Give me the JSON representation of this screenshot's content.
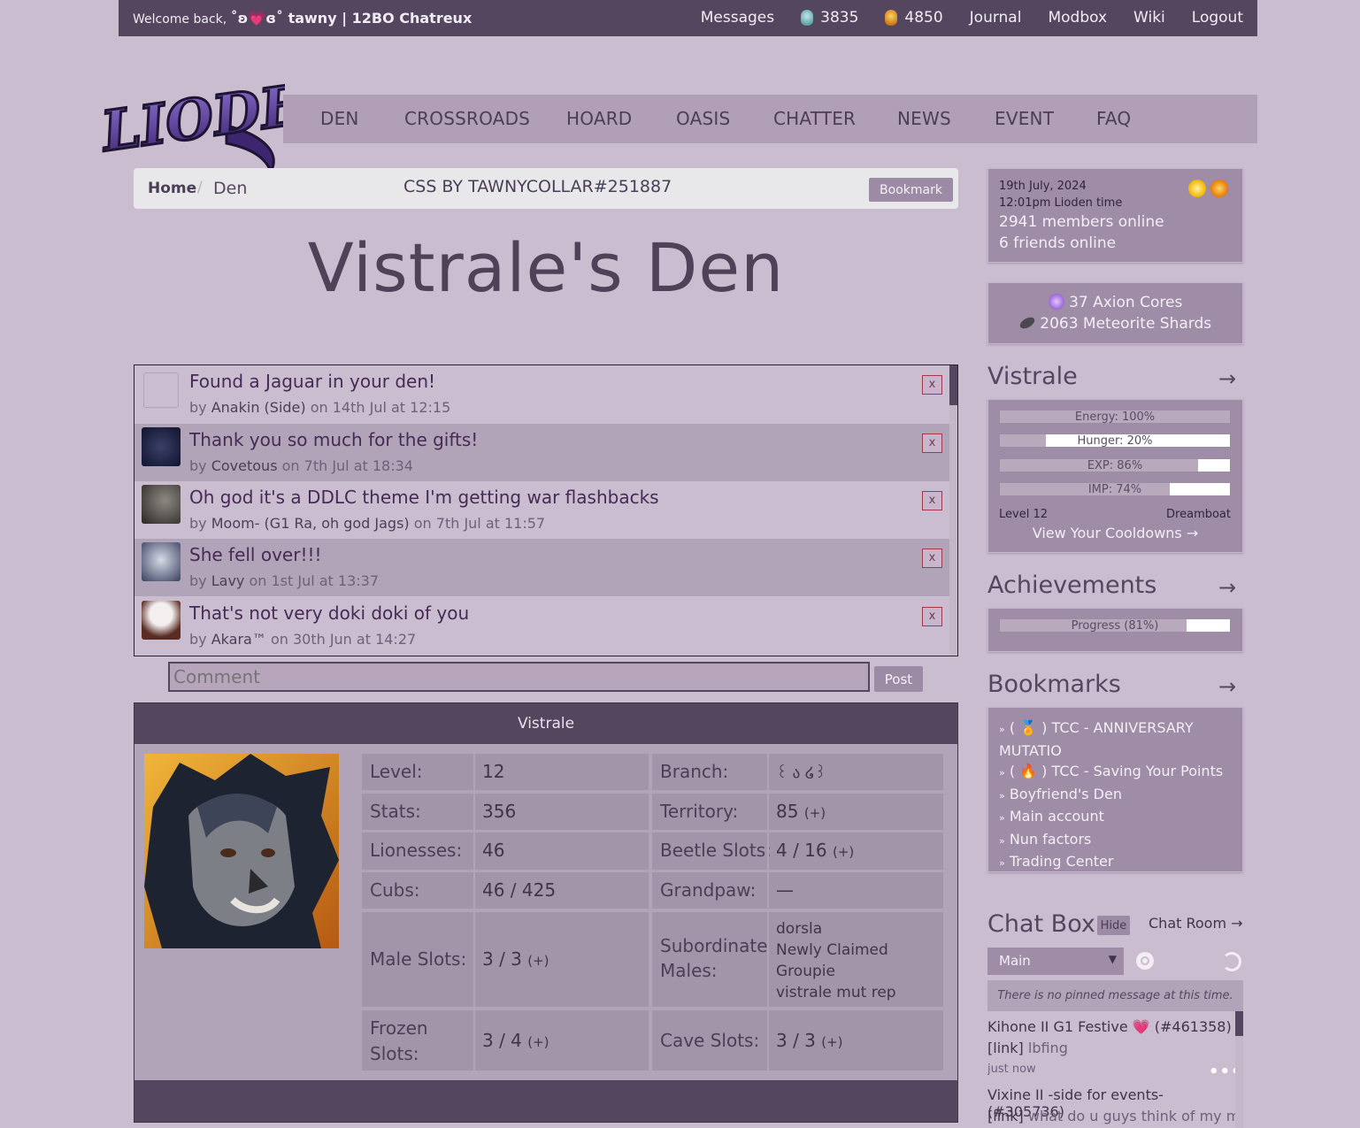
{
  "topbar": {
    "welcome_prefix": "Welcome back,",
    "username": "˚ʚ💗ɞ˚ tawny | 12BO Chatreux",
    "nav": [
      "Messages",
      "Journal",
      "Modbox",
      "Wiki",
      "Logout"
    ],
    "currency_teal": "3835",
    "currency_gold": "4850"
  },
  "logo": {
    "text": "LIODEN"
  },
  "mainnav": [
    "DEN",
    "CROSSROADS",
    "HOARD",
    "OASIS",
    "CHATTER",
    "NEWS",
    "EVENT",
    "FAQ"
  ],
  "breadcrumb": {
    "home": "Home",
    "sep": "/",
    "current": "Den",
    "credit": "CSS BY TAWNYCOLLAR#251887",
    "bookmark": "Bookmark"
  },
  "page_title": "Vistrale's Den",
  "comments": [
    {
      "title": "Found a Jaguar in your den!",
      "by": "by",
      "author": "Anakin (Side)",
      "date": "on 14th Jul at 12:15",
      "close": "x"
    },
    {
      "title": "Thank you so much for the gifts!",
      "by": "by",
      "author": "Covetous",
      "date": "on 7th Jul at 18:34",
      "close": "x"
    },
    {
      "title": "Oh god it's a DDLC theme I'm getting war flashbacks",
      "by": "by",
      "author": "Moom- (G1 Ra, oh god Jags)",
      "date": "on 7th Jul at 11:57",
      "close": "x"
    },
    {
      "title": "She fell over!!!",
      "by": "by",
      "author": "Lavy",
      "date": "on 1st Jul at 13:37",
      "close": "x"
    },
    {
      "title": "That's not very doki doki of you",
      "by": "by",
      "author": "Akara™",
      "date": "on 30th Jun at 14:27",
      "close": "x"
    }
  ],
  "comment_form": {
    "placeholder": "Comment",
    "post": "Post"
  },
  "lion": {
    "name": "Vistrale",
    "level_label": "Level:",
    "level": "12",
    "branch_label": "Branch:",
    "branch": "꒰ ა ໒꒱",
    "stats_label": "Stats:",
    "stats": "356",
    "territory_label": "Territory:",
    "territory": "85",
    "lionesses_label": "Lionesses:",
    "lionesses": "46",
    "beetle_label": "Beetle Slots:",
    "beetle": "4 / 16",
    "cubs_label": "Cubs:",
    "cubs": "46 / 425",
    "grandpaw_label": "Grandpaw:",
    "grandpaw": "—",
    "male_label": "Male Slots:",
    "male": "3 / 3",
    "sub_label": "Subordinate Males:",
    "subs": [
      "dorsla",
      "Newly Claimed",
      "Groupie",
      "vistrale mut rep"
    ],
    "frozen_label": "Frozen Slots:",
    "frozen": "3 / 4",
    "cave_label": "Cave Slots:",
    "cave": "3 / 3",
    "plus": "(+)"
  },
  "sidebar": {
    "date": "19th July, 2024",
    "time": "12:01pm Lioden time",
    "members": "2941 members online",
    "friends": "6 friends online",
    "axion": "37 Axion Cores",
    "shards": "2063 Meteorite Shards",
    "lion_name": "Vistrale",
    "arrow": "→",
    "bars": [
      {
        "label": "Energy: 100%",
        "value": 100
      },
      {
        "label": "Hunger: 20%",
        "value": 20
      },
      {
        "label": "EXP: 86%",
        "value": 86
      },
      {
        "label": "IMP: 74%",
        "value": 74
      }
    ],
    "level": "Level 12",
    "rank": "Dreamboat",
    "cooldowns": "View Your Cooldowns →",
    "achievements_title": "Achievements",
    "progress": {
      "label": "Progress (81%)",
      "value": 81
    },
    "bookmarks_title": "Bookmarks",
    "bookmarks": [
      "( 🏅 ) TCC - ANNIVERSARY MUTATIO",
      "( 🔥 ) TCC - Saving Your Points",
      "Boyfriend's Den",
      "Main account",
      "Nun factors",
      "Trading Center"
    ],
    "bullet": "»",
    "chat_title": "Chat Box",
    "hide": "Hide",
    "chat_room": "Chat Room →",
    "channel": "Main",
    "pinned": "There is no pinned message at this time.",
    "messages": [
      {
        "author": "Kihone II G1 Festive 💗 (#461358)",
        "link": "[link]",
        "text": "lbfing",
        "time": "just now"
      },
      {
        "author": "Vixine II -side for events- (#305736)",
        "link": "[link]",
        "text": "what do u guys think of my main"
      }
    ]
  },
  "colors": {
    "topbar": "#54465f",
    "page_bg": "#cbbdd0",
    "nav_bg": "#b19eb7",
    "sidebar_box": "#9f8ca6"
  }
}
